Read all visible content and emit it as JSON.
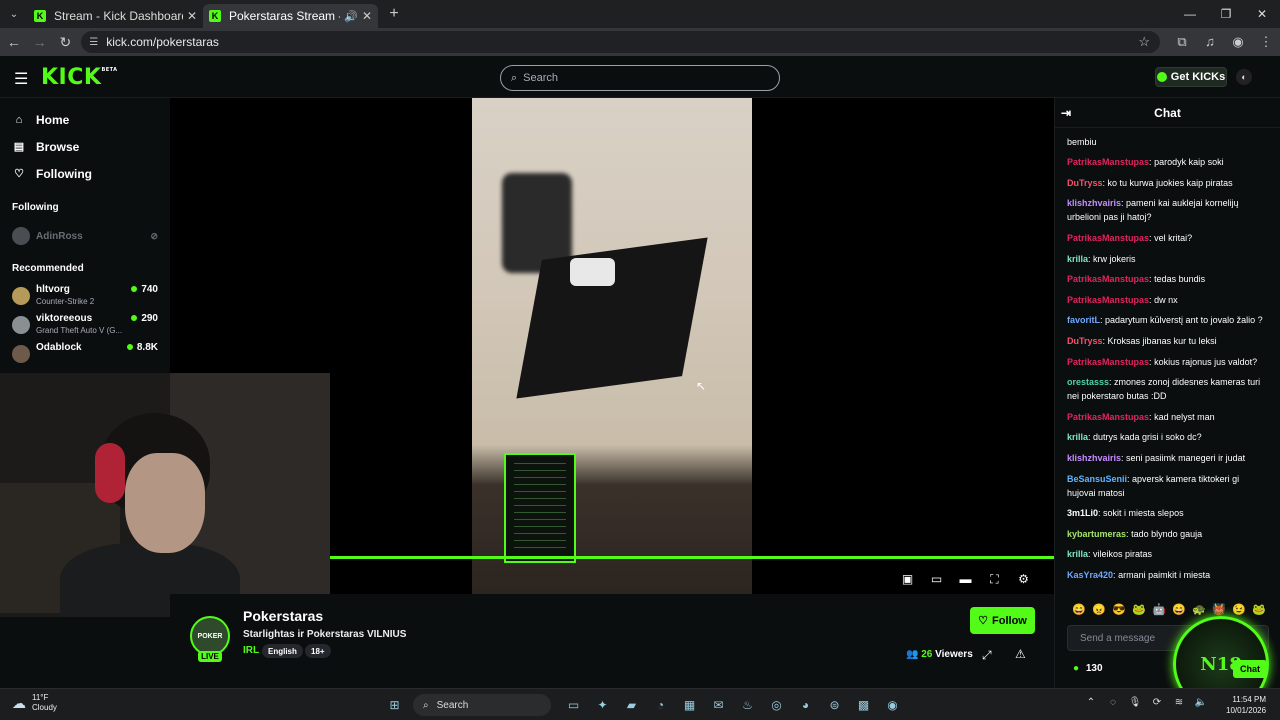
{
  "browser": {
    "tabs": [
      {
        "title": "Stream - Kick Dashboard",
        "active": false
      },
      {
        "title": "Pokerstaras Stream - Watch",
        "active": true
      }
    ],
    "url": "kick.com/pokerstaras"
  },
  "header": {
    "logo": "KICK",
    "logo_badge": "BETA",
    "search_placeholder": "Search",
    "get_kicks_label": "Get KICKs"
  },
  "sidebar": {
    "nav": [
      {
        "label": "Home",
        "icon": "home-icon"
      },
      {
        "label": "Browse",
        "icon": "browse-icon"
      },
      {
        "label": "Following",
        "icon": "heart-icon"
      }
    ],
    "following_title": "Following",
    "following": [
      {
        "name": "AdinRoss",
        "status": "offline"
      }
    ],
    "recommended_title": "Recommended",
    "recommended": [
      {
        "name": "hltvorg",
        "game": "Counter-Strike 2",
        "viewers": "740",
        "avatar_color": "#b59a5a"
      },
      {
        "name": "viktoreeous",
        "game": "Grand Theft Auto V (G...",
        "viewers": "290",
        "avatar_color": "#8a8f94"
      },
      {
        "name": "Odablock",
        "game": "",
        "viewers": "8.8K",
        "avatar_color": "#6e5a4a"
      }
    ]
  },
  "stream": {
    "streamer": "Pokerstaras",
    "title": "Starlightas ir Pokerstaras VILNIUS",
    "category": "IRL",
    "tags": [
      "English",
      "18+"
    ],
    "live_label": "LIVE",
    "avatar_text": "POKER",
    "follow_label": "Follow",
    "viewers_count": "26",
    "viewers_label": "Viewers",
    "progress": 1.0
  },
  "chat": {
    "title": "Chat",
    "messages": [
      {
        "user": "",
        "text": "bembiu",
        "color": "#ffffff"
      },
      {
        "user": "PatrikasManstupas",
        "text": "parodyk kaip soki",
        "color": "#e0245e"
      },
      {
        "user": "DuTryss",
        "text": "ko tu kurwa juokies kaip piratas",
        "color": "#ff4d6d"
      },
      {
        "user": "klishzhvairis",
        "text": "pameni kai auklejai kornelijų urbelioni pas ji hatoj?",
        "color": "#c58cff"
      },
      {
        "user": "PatrikasManstupas",
        "text": "vel kritai?",
        "color": "#e0245e"
      },
      {
        "user": "krilla",
        "text": "krw jokeris",
        "color": "#7fe7c4"
      },
      {
        "user": "PatrikasManstupas",
        "text": "tedas bundis",
        "color": "#e0245e"
      },
      {
        "user": "PatrikasManstupas",
        "text": "dw nx",
        "color": "#e0245e"
      },
      {
        "user": "favoritL",
        "text": "padarytum kūlverstį ant to jovalo žalio ?",
        "color": "#6fa8ff"
      },
      {
        "user": "DuTryss",
        "text": "Kroksas jibanas kur tu leksi",
        "color": "#ff4d6d"
      },
      {
        "user": "PatrikasManstupas",
        "text": "kokius rajonus jus valdot?",
        "color": "#e0245e"
      },
      {
        "user": "orestasss",
        "text": "zmones zonoj didesnes kameras turi nei pokerstaro butas :DD",
        "color": "#4fd1a5"
      },
      {
        "user": "PatrikasManstupas",
        "text": "kad nelyst man",
        "color": "#e0245e"
      },
      {
        "user": "krilla",
        "text": "dutrys kada grisi i soko dc?",
        "color": "#7fe7c4"
      },
      {
        "user": "klishzhvairis",
        "text": "seni pasiimk manegeri ir judat",
        "color": "#c58cff"
      },
      {
        "user": "BeSansuSenii",
        "text": "apversk kamera tiktokeri gi hujovai matosi",
        "color": "#5fb4ff"
      },
      {
        "user": "3m1Li0",
        "text": "sokit i miesta slepos",
        "color": "#ffffff"
      },
      {
        "user": "kybartumeras",
        "text": "tado blyndo gauja",
        "color": "#a6e36a"
      },
      {
        "user": "krilla",
        "text": "vileikos piratas",
        "color": "#7fe7c4"
      },
      {
        "user": "KasYra420",
        "text": "armani paimkit i miesta",
        "color": "#6fa8ff"
      }
    ],
    "input_placeholder": "Send a message",
    "points": "130",
    "chat_button_label": "Chat",
    "overlay_badge": "N18"
  },
  "taskbar": {
    "weather_temp": "11°F",
    "weather_desc": "Cloudy",
    "search_label": "Search",
    "time": "11:54 PM",
    "date": "10/01/2026"
  },
  "colors": {
    "accent": "#53fc18",
    "background": "#0b0e0f"
  }
}
